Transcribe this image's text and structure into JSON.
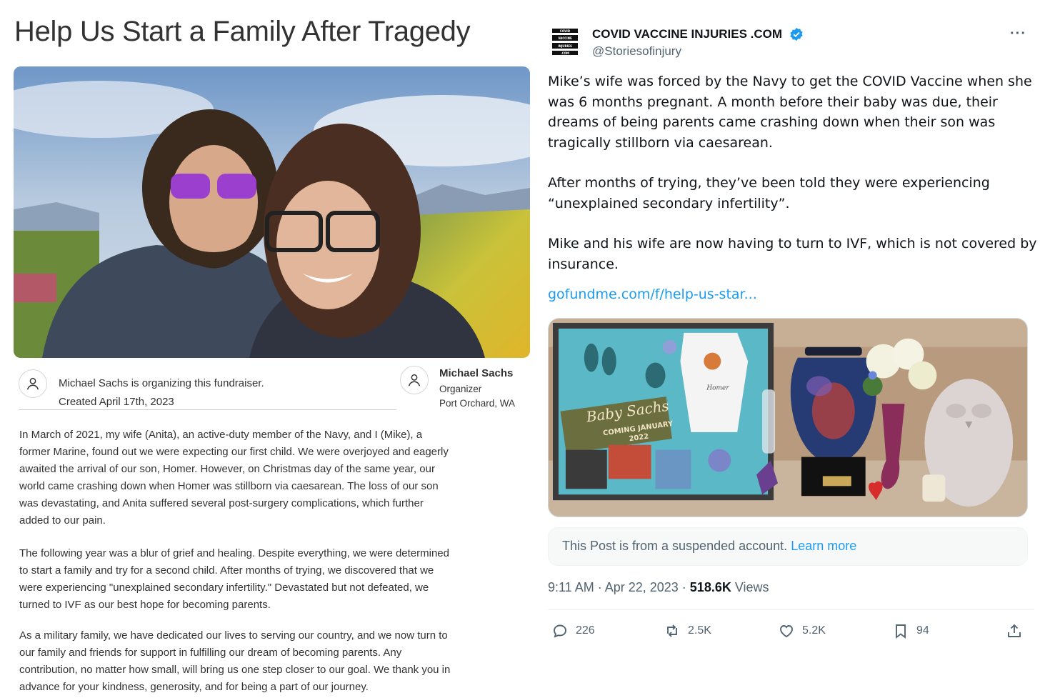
{
  "gofundme": {
    "title": "Help Us Start a Family After Tragedy",
    "organizing_text": "Michael Sachs is organizing this fundraiser.",
    "created": "Created April 17th, 2023",
    "organizer": {
      "name": "Michael Sachs",
      "role": "Organizer",
      "location": "Port Orchard, WA"
    },
    "story": [
      [
        "In March of 2021, my wife (Anita), an active-duty member of the Navy, and I (Mike), a",
        "former Marine, found out we were expecting our first child. We were overjoyed and eagerly",
        "awaited the arrival of our son, Homer. However, on Christmas day of the same year, our",
        "world came crashing down when Homer was stillborn via caesarean. The loss of our son",
        "was devastating, and Anita suffered several post-surgery complications, which further",
        "added to our pain."
      ],
      [
        "The following year was a blur of grief and healing. Despite everything, we were determined",
        "to start a family and try for a second child. After months of trying, we discovered that we",
        "were experiencing \"unexplained secondary infertility.\" Devastated but not defeated, we",
        "turned to IVF as our best hope for becoming parents."
      ],
      [
        "As a military family, we have dedicated our lives to serving our country, and we now turn to",
        "our family and friends for support in fulfilling our dream of becoming parents. Any",
        "contribution, no matter how small, will bring us one step closer to our goal. We thank you in",
        "advance for your kindness, generosity, and for being a part of our journey."
      ]
    ]
  },
  "tweet": {
    "avatar_text": [
      "COVID",
      "VACCINE",
      "INJURIES",
      ".COM"
    ],
    "author_name": "COVID VACCINE INJURIES .COM",
    "handle": "@Storiesofinjury",
    "more_label": "···",
    "paragraphs": [
      [
        "Mike’s wife was forced by the Navy to get the COVID Vaccine when she",
        "was 6 months pregnant. A month before their baby was due, their",
        "dreams of being parents came crashing down when their son was",
        "tragically stillborn via caesarean."
      ],
      [
        "After months of trying, they’ve been told they were experiencing",
        "“unexplained secondary infertility”."
      ],
      [
        "Mike and his wife are now having to turn to IVF, which is not covered by",
        "insurance."
      ]
    ],
    "link": "gofundme.com/f/help-us-star...",
    "media_text": {
      "plaque_line1": "Baby Sachs",
      "plaque_line2": "COMING JANUARY",
      "plaque_line3": "2022",
      "onesie": "Homer"
    },
    "notice_text": "This Post is from a suspended account.",
    "notice_link": "Learn more",
    "time": "9:11 AM · Apr 22, 2023 · ",
    "views_count": "518.6K",
    "views_label": "Views",
    "actions": {
      "replies": "226",
      "reposts": "2.5K",
      "likes": "5.2K",
      "bookmarks": "94"
    },
    "colors": {
      "accent": "#1d9bf0",
      "muted": "#536471",
      "text": "#0f1419"
    }
  }
}
